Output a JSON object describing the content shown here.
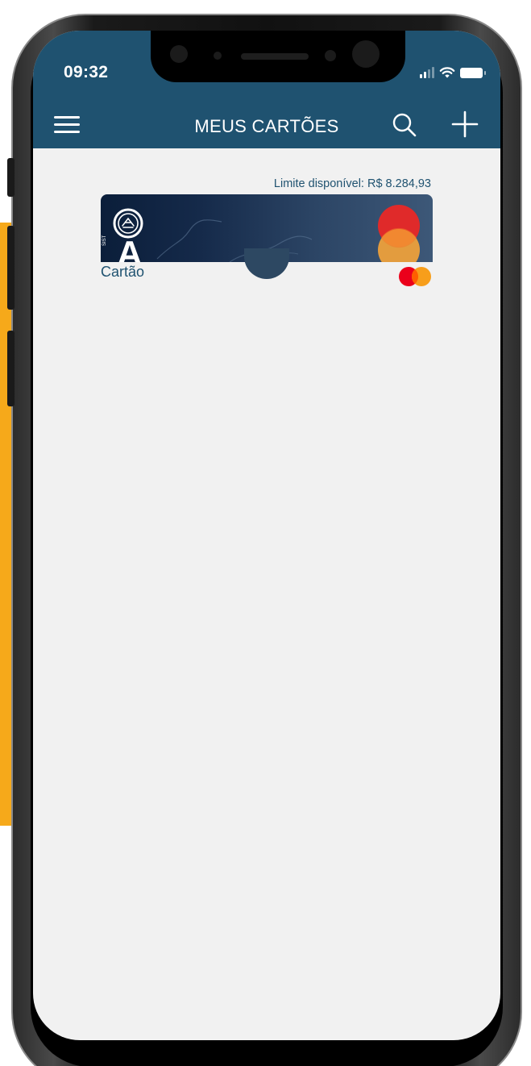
{
  "status_bar": {
    "time": "09:32"
  },
  "header": {
    "title": "MEUS CARTÕES",
    "menu_icon": "hamburger-menu-icon",
    "search_icon": "search-icon",
    "add_icon": "plus-icon"
  },
  "cards": [
    {
      "limit_text": "Limite disponível: R$ 8.284,93",
      "caption": "Cartão",
      "brand": "mastercard",
      "brand_letter": "A",
      "side_text": "SIST"
    }
  ],
  "colors": {
    "header_bg": "#1f5270",
    "screen_bg": "#f1f1f1",
    "accent_text": "#1f5270",
    "card_dark": "#0b1e3a",
    "mastercard_red": "#eb001b",
    "mastercard_orange": "#f79e1b",
    "side_accent": "#f6a91a"
  }
}
